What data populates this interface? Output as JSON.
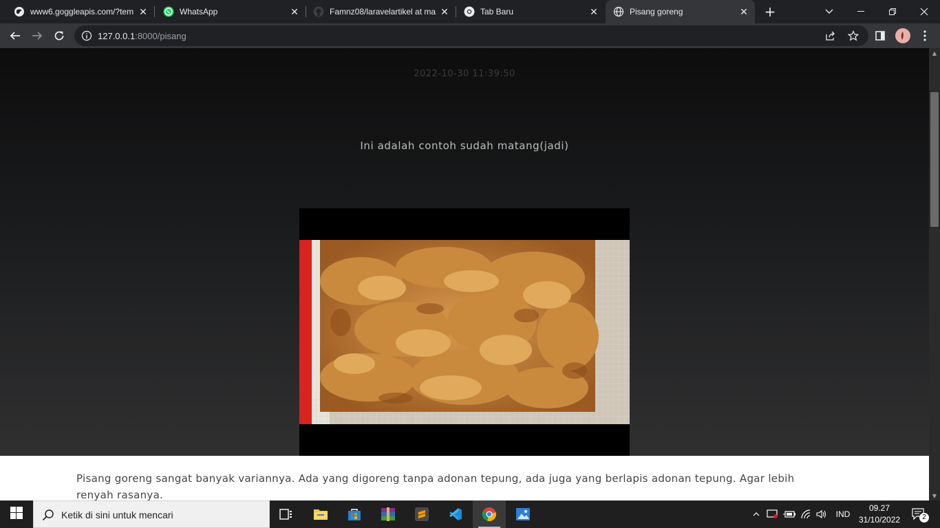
{
  "browser": {
    "tabs": [
      {
        "title": "www6.goggleapis.com/?tem",
        "icon": "globe-icon",
        "active": false
      },
      {
        "title": "WhatsApp",
        "icon": "whatsapp-icon",
        "active": false
      },
      {
        "title": "Famnz08/laravelartikel at ma",
        "icon": "github-icon",
        "active": false
      },
      {
        "title": "Tab Baru",
        "icon": "chrome-icon",
        "active": false
      },
      {
        "title": "Pisang goreng",
        "icon": "globe-icon",
        "active": true
      }
    ],
    "url_host": "127.0.0.1",
    "url_path": ":8000/pisang"
  },
  "page": {
    "date": "2022-10-30 11:39:50",
    "caption": "Ini adalah contoh sudah matang(jadi)",
    "article_text": "Pisang goreng sangat banyak variannya. Ada yang digoreng tanpa adonan tepung, ada juga yang berlapis adonan tepung. Agar lebih renyah rasanya."
  },
  "taskbar": {
    "search_placeholder": "Ketik di sini untuk mencari",
    "language": "IND",
    "time": "09.27",
    "date": "31/10/2022",
    "notification_count": "2",
    "apps": [
      "task-view-icon",
      "file-explorer-icon",
      "store-icon",
      "winrar-icon",
      "sublime-text-icon",
      "vscode-icon",
      "chrome-icon",
      "photos-icon"
    ]
  },
  "colors": {
    "tabstrip": "#202124",
    "toolbar": "#35363a",
    "taskbar": "#1f1f1f",
    "accent": "#9ac8f2"
  }
}
